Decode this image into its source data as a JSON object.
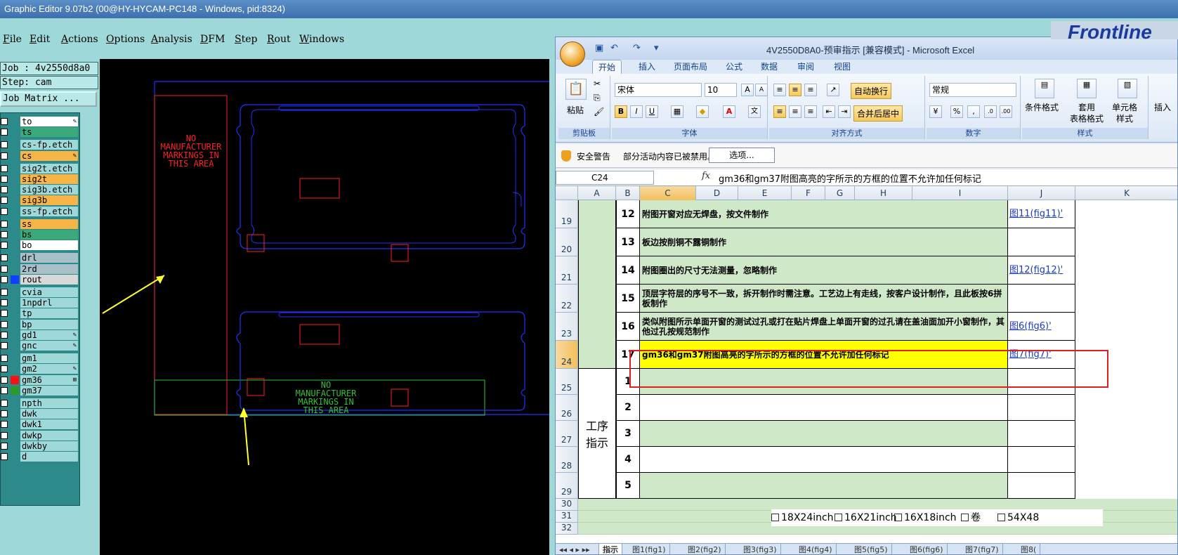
{
  "host_app": {
    "title": "Graphic Editor 9.07b2 (00@HY-HYCAM-PC148 - Windows, pid:8324)",
    "menu": [
      "File",
      "Edit",
      "Actions",
      "Options",
      "Analysis",
      "DFM",
      "Step",
      "Rout",
      "Windows"
    ],
    "job_label": "Job : 4v2550d8a0",
    "step_label": "Step: cam",
    "job_matrix_label": "Job Matrix ..."
  },
  "layers": [
    {
      "name": "to",
      "bg": "#ffffff",
      "mark": "✎",
      "swatch": ""
    },
    {
      "name": "ts",
      "bg": "#3aa878",
      "mark": "",
      "swatch": ""
    },
    {
      "name": "cs-fp.etch",
      "bg": "#9fd8d8",
      "mark": "",
      "swatch": ""
    },
    {
      "name": "cs",
      "bg": "#f7b547",
      "mark": "✎",
      "swatch": ""
    },
    {
      "name": "sig2t.etch",
      "bg": "#9fd8d8",
      "mark": "",
      "swatch": ""
    },
    {
      "name": "sig2t",
      "bg": "#f7b547",
      "mark": "",
      "swatch": ""
    },
    {
      "name": "sig3b.etch",
      "bg": "#9fd8d8",
      "mark": "",
      "swatch": ""
    },
    {
      "name": "sig3b",
      "bg": "#f7b547",
      "mark": "",
      "swatch": ""
    },
    {
      "name": "ss-fp.etch",
      "bg": "#9fd8d8",
      "mark": "",
      "swatch": ""
    },
    {
      "name": "ss",
      "bg": "#f7b547",
      "mark": "",
      "swatch": ""
    },
    {
      "name": "bs",
      "bg": "#3aa878",
      "mark": "",
      "swatch": ""
    },
    {
      "name": "bo",
      "bg": "#ffffff",
      "mark": "",
      "swatch": ""
    },
    {
      "name": "drl",
      "bg": "#a8c0c8",
      "mark": "",
      "swatch": ""
    },
    {
      "name": "2rd",
      "bg": "#a8c0c8",
      "mark": "",
      "swatch": ""
    },
    {
      "name": "rout",
      "bg": "#d8d8d8",
      "mark": "",
      "swatch": "#1040ff"
    },
    {
      "name": "cvia",
      "bg": "#9fd8d8",
      "mark": "",
      "swatch": ""
    },
    {
      "name": "1npdrl",
      "bg": "#9fd8d8",
      "mark": "",
      "swatch": ""
    },
    {
      "name": "tp",
      "bg": "#9fd8d8",
      "mark": "",
      "swatch": ""
    },
    {
      "name": "bp",
      "bg": "#9fd8d8",
      "mark": "",
      "swatch": ""
    },
    {
      "name": "gd1",
      "bg": "#9fd8d8",
      "mark": "✎",
      "swatch": ""
    },
    {
      "name": "gnc",
      "bg": "#9fd8d8",
      "mark": "✎",
      "swatch": ""
    },
    {
      "name": "gm1",
      "bg": "#9fd8d8",
      "mark": "",
      "swatch": ""
    },
    {
      "name": "gm2",
      "bg": "#9fd8d8",
      "mark": "✎",
      "swatch": ""
    },
    {
      "name": "gm36",
      "bg": "#9fd8d8",
      "mark": "⊞",
      "swatch": "#ff1010"
    },
    {
      "name": "gm37",
      "bg": "#9fd8d8",
      "mark": "",
      "swatch": "#2a9a2a"
    },
    {
      "name": "npth",
      "bg": "#9fd8d8",
      "mark": "",
      "swatch": ""
    },
    {
      "name": "dwk",
      "bg": "#9fd8d8",
      "mark": "",
      "swatch": ""
    },
    {
      "name": "dwk1",
      "bg": "#9fd8d8",
      "mark": "",
      "swatch": ""
    },
    {
      "name": "dwkp",
      "bg": "#9fd8d8",
      "mark": "",
      "swatch": ""
    },
    {
      "name": "dwkby",
      "bg": "#9fd8d8",
      "mark": "",
      "swatch": ""
    },
    {
      "name": "d",
      "bg": "#9fd8d8",
      "mark": "",
      "swatch": ""
    }
  ],
  "canvas": {
    "note_red": [
      "NO",
      "MANUFACTURER",
      "MARKINGS IN",
      "THIS AREA"
    ],
    "note_green": [
      "NO",
      "MANUFACTURER",
      "MARKINGS IN",
      "THIS AREA"
    ]
  },
  "excel": {
    "title": "4V2550D8A0-预审指示  [兼容模式] - Microsoft Excel",
    "tabs": [
      "开始",
      "插入",
      "页面布局",
      "公式",
      "数据",
      "审阅",
      "视图"
    ],
    "ribbon": {
      "paste": "粘贴",
      "clipboard": "剪贴板",
      "font_name": "宋体",
      "font_size": "10",
      "font_group": "字体",
      "wrap_text": "自动换行",
      "merge_center": "合并后居中",
      "align_group": "对齐方式",
      "number_format": "常规",
      "number_group": "数字",
      "cond_format": "条件格式",
      "table_format_1": "套用",
      "table_format_2": "表格格式",
      "cell_style_1": "单元格",
      "cell_style_2": "样式",
      "style_group": "样式",
      "insert": "插入"
    },
    "security": {
      "label": "安全警告",
      "message": "部分活动内容已被禁用。",
      "options_button": "选项..."
    },
    "name_box": "C24",
    "formula": "gm36和gm37附图高亮的字所示的方框的位置不允许加任何标记",
    "columns": [
      "A",
      "B",
      "C",
      "D",
      "E",
      "F",
      "G",
      "H",
      "I",
      "J",
      "K"
    ],
    "rows": [
      {
        "row": "19",
        "num": "12",
        "text": "附图开窗对应无焊盘，按文件制作",
        "link": "图11(fig11)'"
      },
      {
        "row": "20",
        "num": "13",
        "text": "板边按削铜不露铜制作",
        "link": ""
      },
      {
        "row": "21",
        "num": "14",
        "text": "附图圈出的尺寸无法测量，忽略制作",
        "link": "图12(fig12)'"
      },
      {
        "row": "22",
        "num": "15",
        "text": "顶层字符层的序号不一致，拆开制作时需注意。工艺边上有走线，按客户设计制作，且此板按6拼板制作",
        "link": ""
      },
      {
        "row": "23",
        "num": "16",
        "text": "类似附图所示单面开窗的测试过孔或打在贴片焊盘上单面开窗的过孔请在盖油面加开小窗制作，其他过孔按规范制作",
        "link": "图6(fig6)'"
      },
      {
        "row": "24",
        "num": "17",
        "text": "gm36和gm37附图高亮的字所示的方框的位置不允许加任何标记",
        "link": "图7(fig7)'"
      }
    ],
    "process_rows": [
      {
        "row": "25",
        "num": "1"
      },
      {
        "row": "26",
        "num": "2"
      },
      {
        "row": "27",
        "num": "3"
      },
      {
        "row": "28",
        "num": "4"
      },
      {
        "row": "29",
        "num": "5"
      }
    ],
    "process_label": [
      "工序",
      "指示"
    ],
    "extra_rows": [
      "30",
      "31",
      "32"
    ],
    "paper_options": [
      "18X24inch",
      "16X21inch",
      "16X18inch",
      "卷",
      "54X48"
    ],
    "sheet_tabs": [
      "指示",
      "图1(fig1)",
      "图2(fig2)",
      "图3(fig3)",
      "图4(fig4)",
      "图5(fig5)",
      "图6(fig6)",
      "图7(fig7)",
      "图8("
    ]
  },
  "frontline_logo": "Frontline"
}
